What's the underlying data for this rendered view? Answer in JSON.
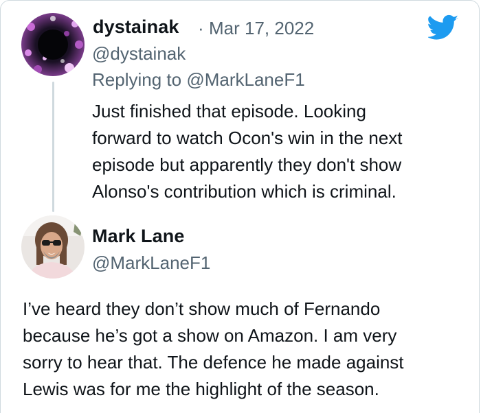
{
  "first_tweet": {
    "display_name": "dystainak",
    "date_separator": "·",
    "date": "Mar 17, 2022",
    "handle": "@dystainak",
    "replying_prefix": "Replying to",
    "replying_handle": "@MarkLaneF1",
    "text_lines": [
      "Just finished that episode. Looking",
      "forward to watch Ocon's win in the next",
      "episode but apparently they don't show",
      "Alonso's contribution which is criminal."
    ]
  },
  "reply_tweet": {
    "display_name": "Mark Lane",
    "handle": "@MarkLaneF1",
    "text_lines": [
      "I’ve heard they don’t show much of Fernando",
      "because he’s got a show on Amazon. I am very",
      "sorry to hear that. The defence he made against",
      "Lewis was for me the highlight of the season."
    ]
  },
  "icons": {
    "brand": "twitter-bird-icon",
    "brand_color": "#1d9bf0"
  },
  "colors": {
    "text": "#0f1419",
    "muted": "#536471",
    "divider": "#cfd9de"
  }
}
